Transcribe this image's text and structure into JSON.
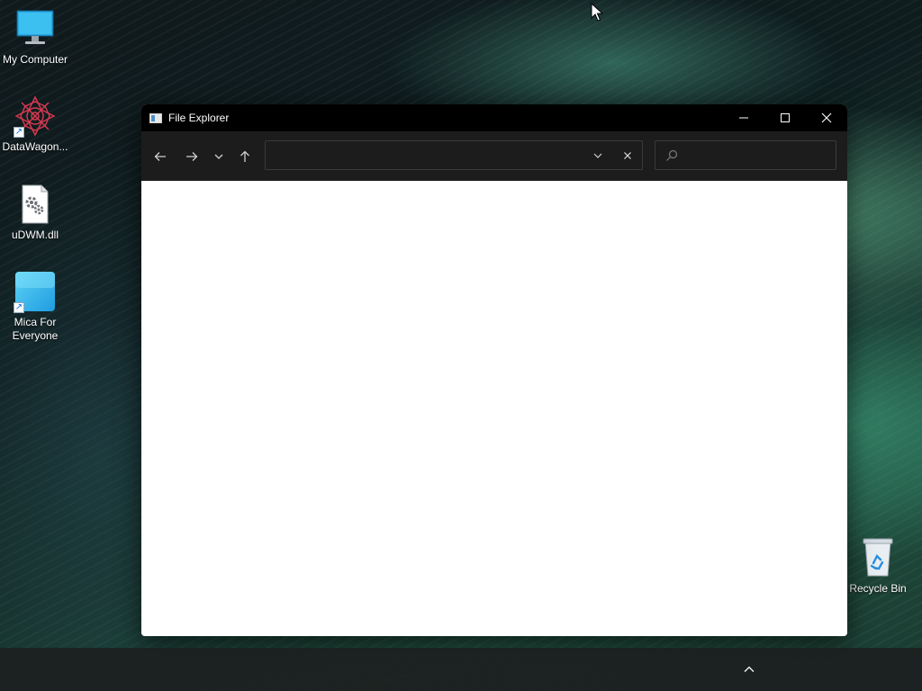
{
  "desktop": {
    "icons": [
      {
        "label": "My Computer",
        "icon": "monitor-icon"
      },
      {
        "label": "DataWagon...",
        "icon": "datawagon-icon",
        "shortcut": true
      },
      {
        "label": "uDWM.dll",
        "icon": "dll-file-icon"
      },
      {
        "label": "Mica For Everyone",
        "icon": "mica-icon",
        "shortcut": true
      },
      {
        "label": "Recycle Bin",
        "icon": "recycle-bin-icon"
      }
    ]
  },
  "window": {
    "title": "File Explorer",
    "address": {
      "value": "",
      "placeholder": ""
    },
    "search": {
      "value": "",
      "placeholder": ""
    },
    "nav_icons": [
      "back-arrow-icon",
      "forward-arrow-icon",
      "recent-dropdown-icon",
      "up-arrow-icon"
    ],
    "caption_icons": [
      "minimize-icon",
      "maximize-icon",
      "close-icon"
    ]
  },
  "taskbar": {
    "tray_icon": "show-hidden-icons-chevron"
  },
  "colors": {
    "titlebar": "#000000",
    "toolbar": "#1c1c1c",
    "content": "#ffffff",
    "taskbar": "#1c2020"
  }
}
